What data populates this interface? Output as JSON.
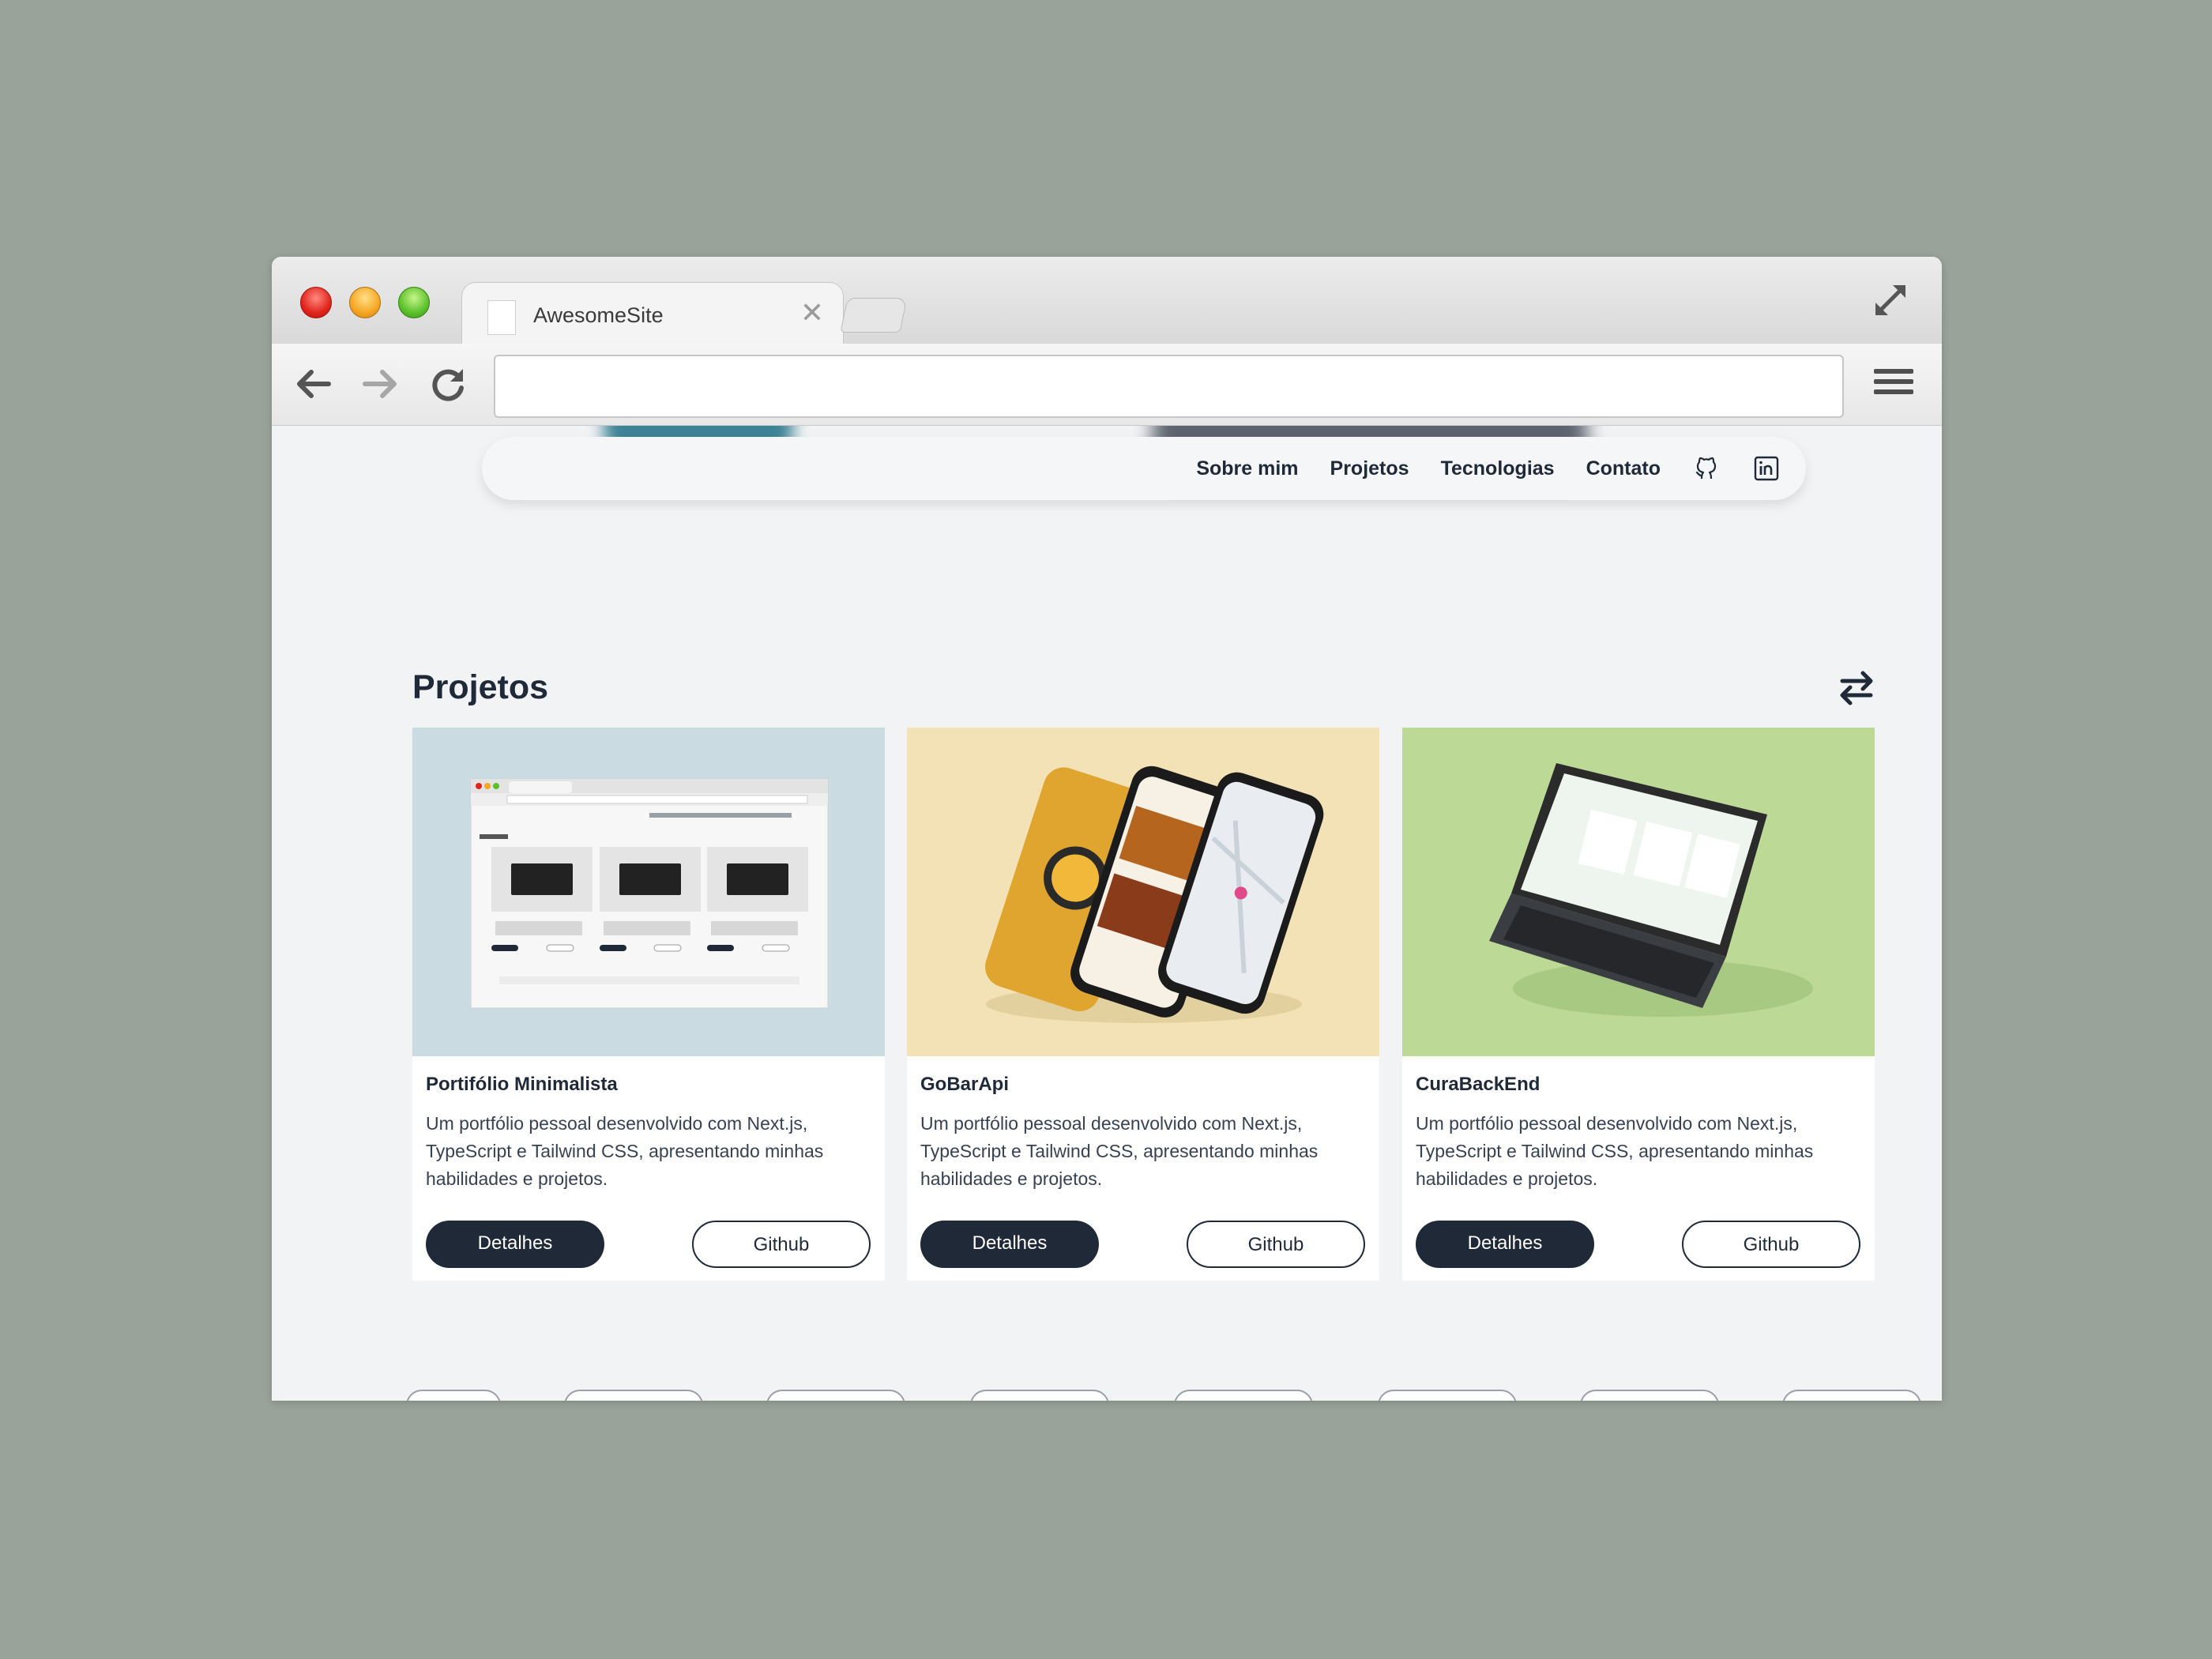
{
  "browser": {
    "tab_title": "AwesomeSite",
    "address_value": ""
  },
  "site_nav": {
    "links": [
      "Sobre mim",
      "Projetos",
      "Tecnologias",
      "Contato"
    ],
    "icons": [
      "github-icon",
      "linkedin-icon"
    ]
  },
  "projects": {
    "title": "Projetos",
    "toggle_icon": "swap-arrows-icon",
    "cards": [
      {
        "name": "Portifólio Minimalista",
        "description": "Um portfólio pessoal desenvolvido com Next.js, TypeScript e Tailwind CSS, apresentando minhas habilidades e projetos.",
        "details_label": "Detalhes",
        "github_label": "Github",
        "image_bg": "#cadbe2"
      },
      {
        "name": "GoBarApi",
        "description": "Um portfólio pessoal desenvolvido com Next.js, TypeScript e Tailwind CSS, apresentando minhas habilidades e projetos.",
        "details_label": "Detalhes",
        "github_label": "Github",
        "image_bg": "#f2e2b6"
      },
      {
        "name": "CuraBackEnd",
        "description": "Um portfólio pessoal desenvolvido com Next.js, TypeScript e Tailwind CSS, apresentando minhas habilidades e projetos.",
        "details_label": "Detalhes",
        "github_label": "Github",
        "image_bg": "#bcd996"
      }
    ]
  },
  "colors": {
    "primary": "#1f2937",
    "page_bg": "#f2f3f5",
    "backdrop": "#99a39a"
  }
}
